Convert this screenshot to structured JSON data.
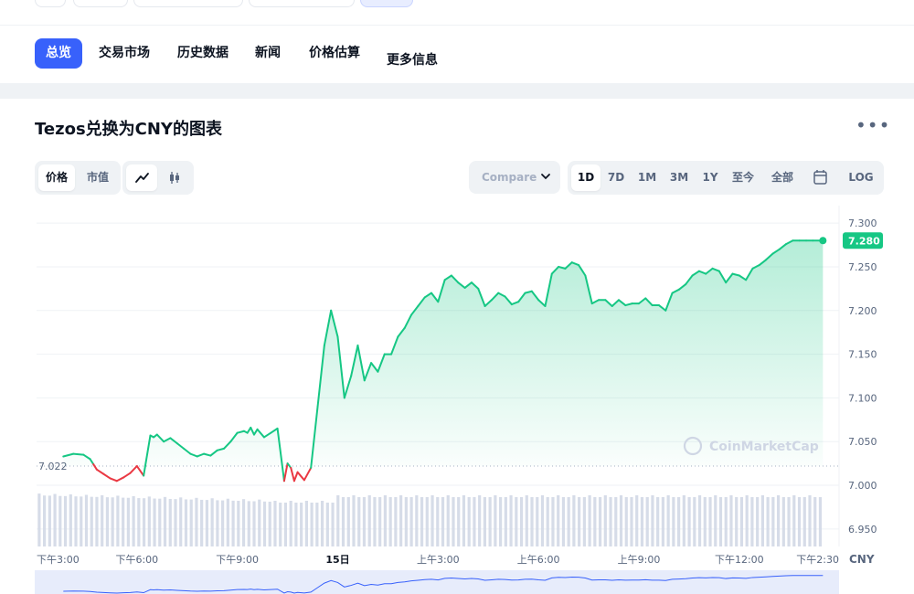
{
  "tabs": [
    {
      "label": "总览",
      "active": true
    },
    {
      "label": "交易市场",
      "active": false
    },
    {
      "label": "历史数据",
      "active": false
    },
    {
      "label": "新闻",
      "active": false
    },
    {
      "label": "价格估算",
      "active": false
    },
    {
      "label": "更多信息",
      "active": false
    }
  ],
  "card": {
    "title": "Tezos兑换为CNY的图表",
    "more_icon": "ellipsis-icon"
  },
  "toggles": {
    "metric": [
      {
        "label": "价格",
        "active": true
      },
      {
        "label": "市值",
        "active": false
      }
    ],
    "chart_style": [
      {
        "icon": "line-chart-icon",
        "active": true
      },
      {
        "icon": "candlestick-icon",
        "active": false
      }
    ]
  },
  "compare": {
    "label": "Compare",
    "icon": "chevron-down-icon"
  },
  "ranges": [
    {
      "label": "1D",
      "active": true
    },
    {
      "label": "7D",
      "active": false
    },
    {
      "label": "1M",
      "active": false
    },
    {
      "label": "3M",
      "active": false
    },
    {
      "label": "1Y",
      "active": false
    },
    {
      "label": "至今",
      "active": false
    },
    {
      "label": "全部",
      "active": false
    },
    {
      "icon": "calendar-icon",
      "active": false
    },
    {
      "label": "LOG",
      "active": false
    }
  ],
  "colors": {
    "accent": "#3861fb",
    "up": "#16c784",
    "down": "#ea3943",
    "muted": "#58667e"
  },
  "chart_data": {
    "type": "line",
    "ylabel": "CNY",
    "ylim": [
      6.93,
      7.32
    ],
    "yticks": [
      6.95,
      7.0,
      7.05,
      7.1,
      7.15,
      7.2,
      7.25,
      7.3
    ],
    "ytick_labels": [
      "6.950",
      "7.000",
      "7.050",
      "7.100",
      "7.150",
      "7.200",
      "7.250",
      "7.300"
    ],
    "xlim": [
      0,
      23.6
    ],
    "xticks": [
      {
        "label": "下午3:00",
        "x": 0
      },
      {
        "label": "下午6:00",
        "x": 3
      },
      {
        "label": "下午9:00",
        "x": 6
      },
      {
        "label": "15日",
        "x": 9
      },
      {
        "label": "上午3:00",
        "x": 12
      },
      {
        "label": "上午6:00",
        "x": 15
      },
      {
        "label": "上午9:00",
        "x": 18
      },
      {
        "label": "下午12:00",
        "x": 21
      },
      {
        "label": "下午2:30",
        "x": 23.5
      }
    ],
    "baseline": 7.022,
    "baseline_label": "7.022",
    "current_value": 7.28,
    "current_label": "7.280",
    "watermark": "CoinMarketCap",
    "series": [
      {
        "x": [
          0.8,
          1.1,
          1.4,
          1.6,
          1.7,
          1.8,
          2.0,
          2.2,
          2.4,
          2.6,
          2.8,
          3.0,
          3.2,
          3.4,
          3.5,
          3.6,
          3.8,
          4.0,
          4.2,
          4.4,
          4.6,
          4.8,
          5.0,
          5.2,
          5.4,
          5.6,
          5.8,
          6.0,
          6.2,
          6.3,
          6.4,
          6.5,
          6.6,
          6.8,
          7.0,
          7.2,
          7.4,
          7.5,
          7.6,
          7.7,
          7.8,
          8.0,
          8.2,
          8.4,
          8.6,
          8.8,
          9.0,
          9.2,
          9.4,
          9.6,
          9.8,
          10.0,
          10.2,
          10.4,
          10.6,
          10.8,
          11.0,
          11.2,
          11.4,
          11.6,
          11.8,
          12.0,
          12.2,
          12.4,
          12.6,
          12.8,
          13.0,
          13.2,
          13.4,
          13.6,
          13.8,
          14.0,
          14.2,
          14.4,
          14.6,
          14.8,
          15.0,
          15.2,
          15.4,
          15.6,
          15.8,
          16.0,
          16.2,
          16.4,
          16.6,
          16.8,
          17.0,
          17.2,
          17.4,
          17.6,
          17.8,
          18.0,
          18.2,
          18.4,
          18.6,
          18.8,
          19.0,
          19.2,
          19.4,
          19.6,
          19.8,
          20.0,
          20.2,
          20.4,
          20.6,
          20.8,
          21.0,
          21.2,
          21.4,
          21.6,
          21.8,
          22.0,
          22.2,
          22.4,
          22.6,
          22.8,
          23.0,
          23.2,
          23.4,
          23.5
        ],
        "y": [
          7.033,
          7.036,
          7.035,
          7.03,
          7.024,
          7.018,
          7.013,
          7.008,
          7.005,
          7.009,
          7.014,
          7.022,
          7.011,
          7.057,
          7.055,
          7.058,
          7.05,
          7.054,
          7.048,
          7.042,
          7.036,
          7.033,
          7.036,
          7.034,
          7.04,
          7.042,
          7.05,
          7.06,
          7.062,
          7.06,
          7.066,
          7.058,
          7.064,
          7.055,
          7.06,
          7.065,
          7.005,
          7.025,
          7.02,
          7.005,
          7.015,
          7.006,
          7.02,
          7.09,
          7.16,
          7.2,
          7.17,
          7.1,
          7.125,
          7.16,
          7.12,
          7.14,
          7.13,
          7.15,
          7.15,
          7.17,
          7.18,
          7.195,
          7.205,
          7.215,
          7.22,
          7.21,
          7.235,
          7.24,
          7.232,
          7.226,
          7.232,
          7.225,
          7.205,
          7.212,
          7.22,
          7.216,
          7.207,
          7.21,
          7.22,
          7.222,
          7.212,
          7.205,
          7.242,
          7.25,
          7.248,
          7.255,
          7.252,
          7.24,
          7.208,
          7.212,
          7.212,
          7.205,
          7.212,
          7.206,
          7.208,
          7.208,
          7.214,
          7.206,
          7.206,
          7.2,
          7.22,
          7.224,
          7.23,
          7.24,
          7.245,
          7.242,
          7.248,
          7.245,
          7.232,
          7.242,
          7.24,
          7.235,
          7.248,
          7.252,
          7.258,
          7.265,
          7.27,
          7.276,
          7.28,
          7.28,
          7.28,
          7.28,
          7.28,
          7.28
        ]
      }
    ]
  },
  "labels": {
    "currency": "CNY"
  }
}
